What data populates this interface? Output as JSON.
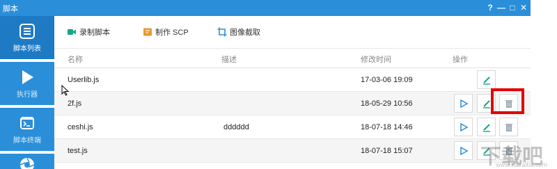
{
  "window": {
    "title": "脚本",
    "controls": [
      "?",
      "—",
      "□",
      "✕"
    ]
  },
  "sidebar": {
    "items": [
      {
        "label": "脚本列表",
        "icon": "script-list-icon",
        "active": true
      },
      {
        "label": "执行器",
        "icon": "play-icon",
        "active": false
      },
      {
        "label": "脚本终端",
        "icon": "terminal-icon",
        "active": false
      },
      {
        "label": "",
        "icon": "aperture-icon",
        "active": false
      }
    ]
  },
  "toolbar": {
    "record_label": "录制脚本",
    "make_scp_label": "制作 SCP",
    "capture_label": "图像截取"
  },
  "table": {
    "headers": [
      "名称",
      "描述",
      "修改时间",
      "操作"
    ],
    "rows": [
      {
        "name": "Userlib.js",
        "desc": "",
        "time": "17-03-06 19:09"
      },
      {
        "name": "2f.js",
        "desc": "",
        "time": "18-05-29 10:56"
      },
      {
        "name": "ceshi.js",
        "desc": "dddddd",
        "time": "18-07-18 14:46"
      },
      {
        "name": "test.js",
        "desc": "",
        "time": "18-07-18 15:07"
      }
    ]
  },
  "watermark": {
    "main": "下载吧",
    "sub": "www.xiazaiba.com"
  },
  "colors": {
    "accent": "#2a8fd8",
    "play": "#2a8fd8",
    "edit": "#1aa389",
    "delete": "#9aa7b0",
    "highlight": "#e20000",
    "record": "#1aa389",
    "make_scp": "#e89a2c",
    "capture": "#2a8fd8"
  }
}
